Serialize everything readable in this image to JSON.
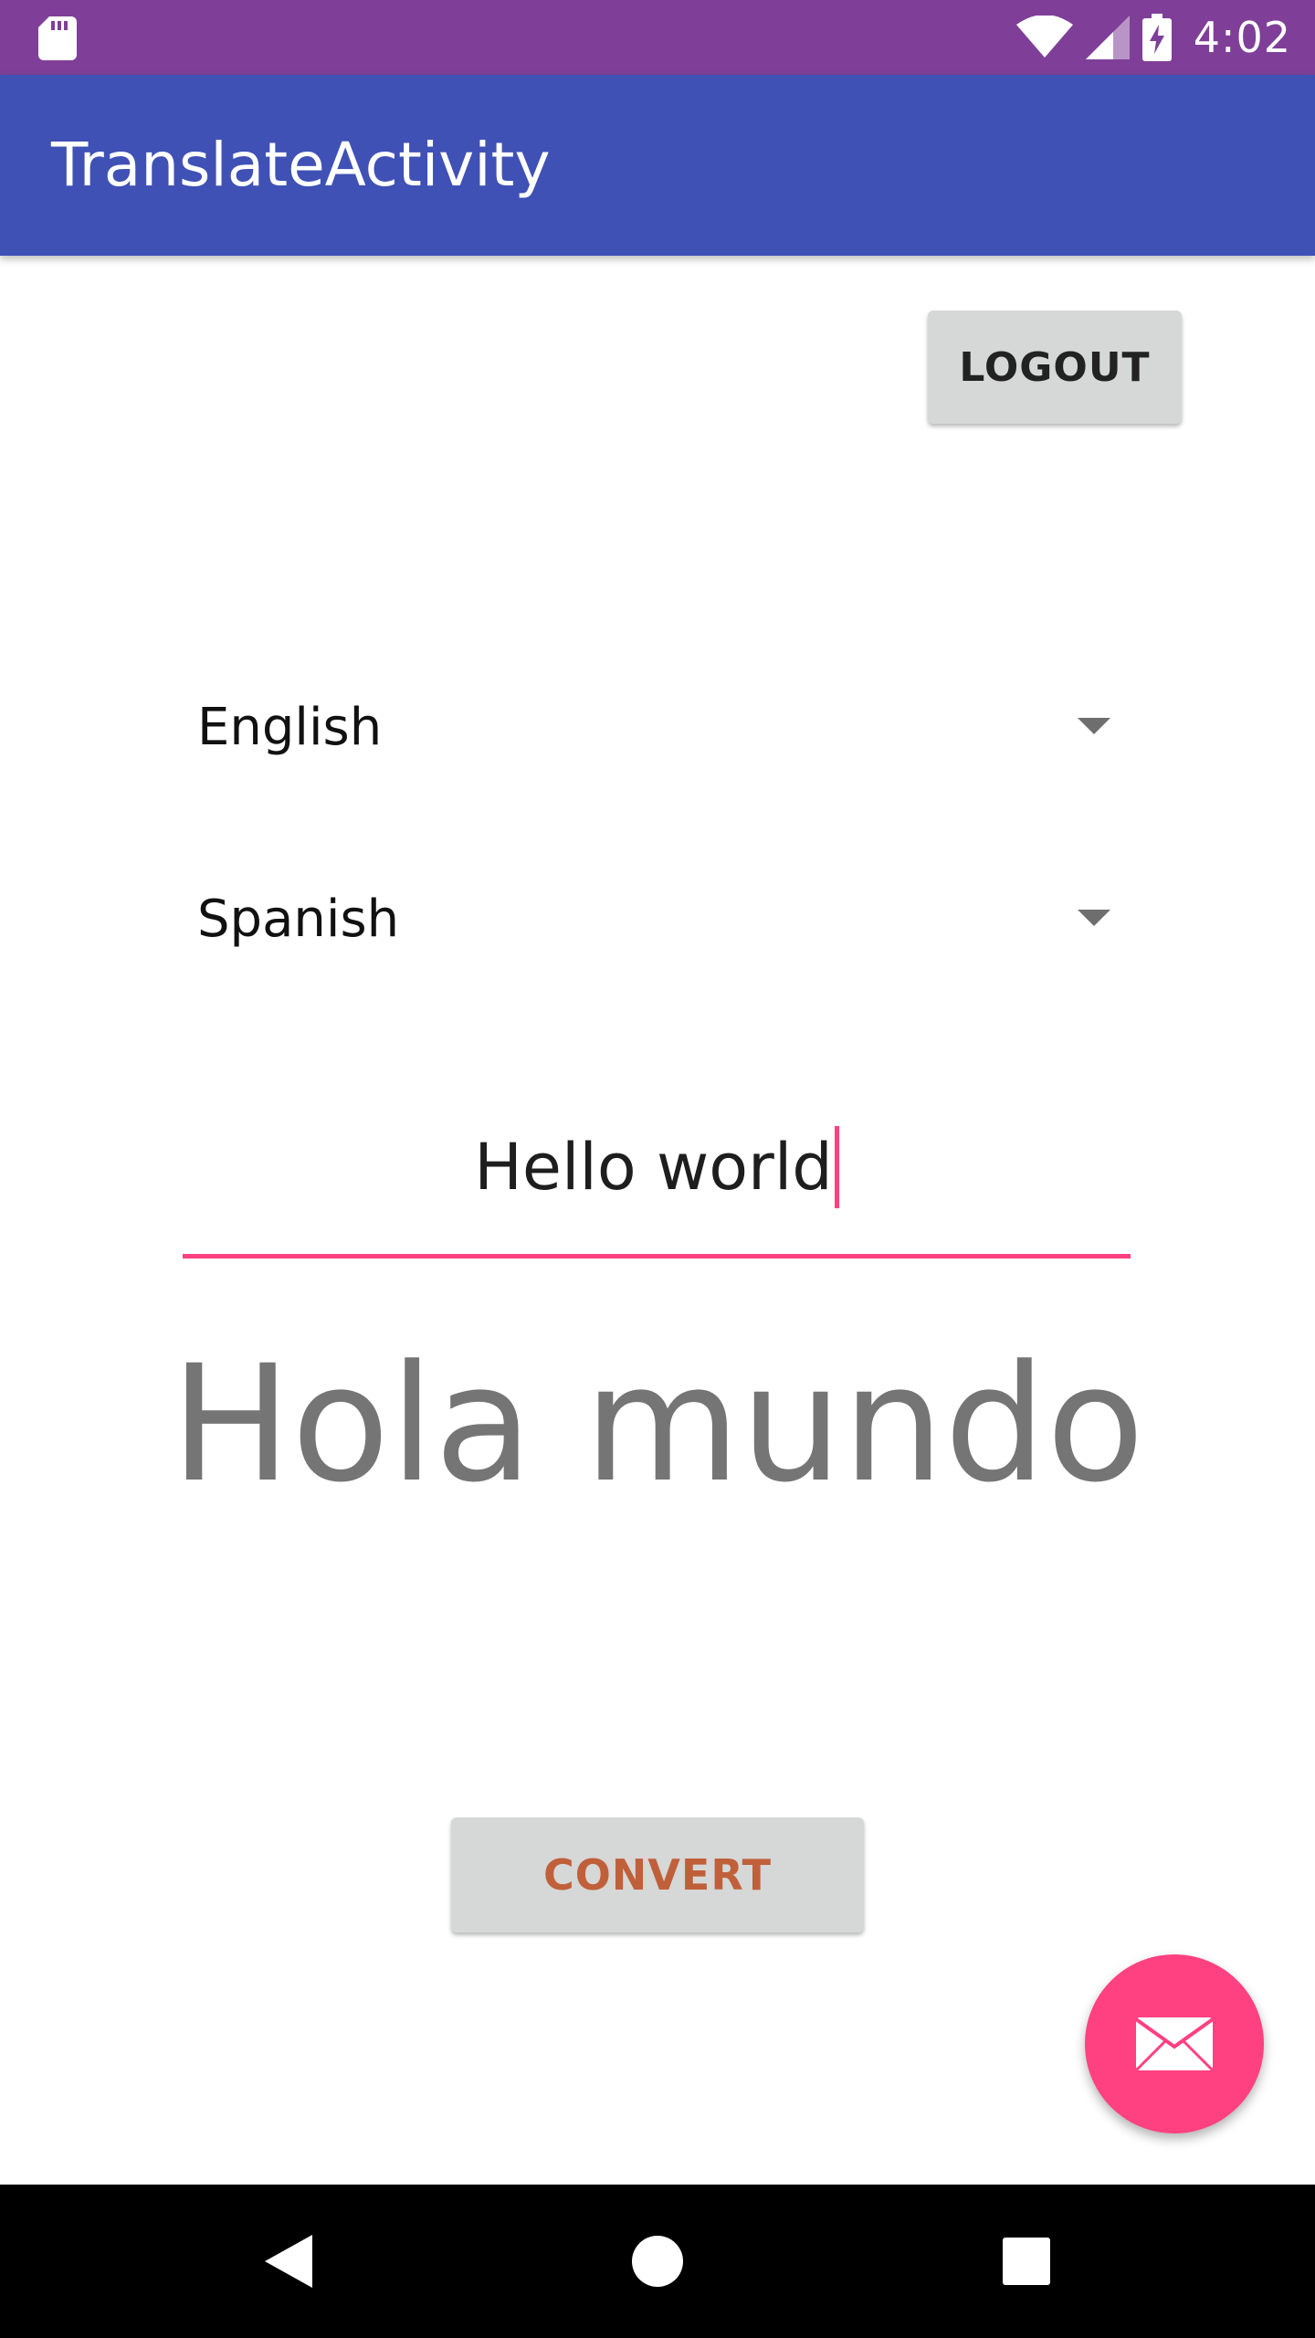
{
  "status_bar": {
    "time": "4:02",
    "icons": [
      "sd-card-icon",
      "wifi-icon",
      "cell-signal-icon",
      "battery-charging-icon"
    ],
    "background_color": "#7f3f98"
  },
  "app_bar": {
    "title": "TranslateActivity",
    "background_color": "#3f51b5"
  },
  "logout_button": {
    "label": "LOGOUT"
  },
  "source_language": {
    "selected": "English"
  },
  "target_language": {
    "selected": "Spanish"
  },
  "input": {
    "value": "Hello world",
    "accent_color": "#ff4081"
  },
  "output": {
    "text": "Hola mundo"
  },
  "convert_button": {
    "label": "CONVERT",
    "text_color": "#c0603a"
  },
  "fab": {
    "icon": "mail-icon",
    "color": "#ff4081"
  },
  "nav_bar": {
    "icons": [
      "back-icon",
      "home-icon",
      "recents-icon"
    ]
  }
}
